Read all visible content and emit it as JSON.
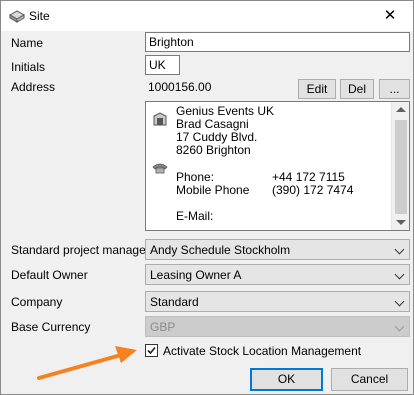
{
  "window": {
    "title": "Site",
    "close_glyph": "✕"
  },
  "fields": {
    "name_label": "Name",
    "name_value": "Brighton",
    "initials_label": "Initials",
    "initials_value": "UK",
    "address_label": "Address",
    "address_id": "1000156.00",
    "edit_label": "Edit",
    "del_label": "Del",
    "more_label": "..."
  },
  "address_card": {
    "company": "Genius Events UK",
    "contact": "Brad Casagni",
    "street": "17 Cuddy Blvd.",
    "city": "8260 Brighton",
    "phone_label": "Phone:",
    "phone_value": "+44 172 7115",
    "mobile_label": "Mobile Phone",
    "mobile_value": "(390) 172 7474",
    "email_label": "E-Mail:"
  },
  "dropdowns": {
    "pm_label": "Standard project manager",
    "pm_value": "Andy Schedule Stockholm",
    "owner_label": "Default Owner",
    "owner_value": "Leasing Owner A",
    "company_label": "Company",
    "company_value": "Standard",
    "currency_label": "Base Currency",
    "currency_value": "GBP"
  },
  "checkbox": {
    "label": "Activate Stock Location Management",
    "checked": true
  },
  "footer": {
    "ok_label": "OK",
    "cancel_label": "Cancel"
  },
  "colors": {
    "annotation_arrow": "#f5821f",
    "focus_border": "#0078d7"
  }
}
